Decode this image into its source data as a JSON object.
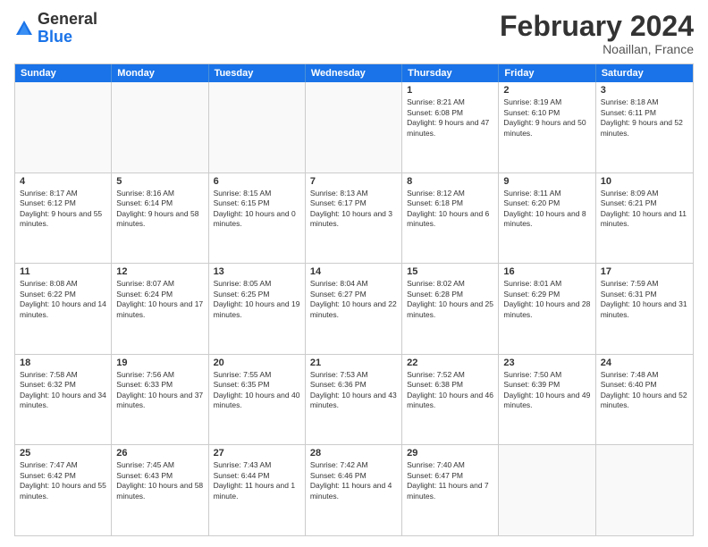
{
  "logo": {
    "general": "General",
    "blue": "Blue"
  },
  "header": {
    "month": "February 2024",
    "location": "Noaillan, France"
  },
  "weekdays": [
    "Sunday",
    "Monday",
    "Tuesday",
    "Wednesday",
    "Thursday",
    "Friday",
    "Saturday"
  ],
  "rows": [
    [
      {
        "day": "",
        "empty": true
      },
      {
        "day": "",
        "empty": true
      },
      {
        "day": "",
        "empty": true
      },
      {
        "day": "",
        "empty": true
      },
      {
        "day": "1",
        "sunrise": "8:21 AM",
        "sunset": "6:08 PM",
        "daylight": "9 hours and 47 minutes."
      },
      {
        "day": "2",
        "sunrise": "8:19 AM",
        "sunset": "6:10 PM",
        "daylight": "9 hours and 50 minutes."
      },
      {
        "day": "3",
        "sunrise": "8:18 AM",
        "sunset": "6:11 PM",
        "daylight": "9 hours and 52 minutes."
      }
    ],
    [
      {
        "day": "4",
        "sunrise": "8:17 AM",
        "sunset": "6:12 PM",
        "daylight": "9 hours and 55 minutes."
      },
      {
        "day": "5",
        "sunrise": "8:16 AM",
        "sunset": "6:14 PM",
        "daylight": "9 hours and 58 minutes."
      },
      {
        "day": "6",
        "sunrise": "8:15 AM",
        "sunset": "6:15 PM",
        "daylight": "10 hours and 0 minutes."
      },
      {
        "day": "7",
        "sunrise": "8:13 AM",
        "sunset": "6:17 PM",
        "daylight": "10 hours and 3 minutes."
      },
      {
        "day": "8",
        "sunrise": "8:12 AM",
        "sunset": "6:18 PM",
        "daylight": "10 hours and 6 minutes."
      },
      {
        "day": "9",
        "sunrise": "8:11 AM",
        "sunset": "6:20 PM",
        "daylight": "10 hours and 8 minutes."
      },
      {
        "day": "10",
        "sunrise": "8:09 AM",
        "sunset": "6:21 PM",
        "daylight": "10 hours and 11 minutes."
      }
    ],
    [
      {
        "day": "11",
        "sunrise": "8:08 AM",
        "sunset": "6:22 PM",
        "daylight": "10 hours and 14 minutes."
      },
      {
        "day": "12",
        "sunrise": "8:07 AM",
        "sunset": "6:24 PM",
        "daylight": "10 hours and 17 minutes."
      },
      {
        "day": "13",
        "sunrise": "8:05 AM",
        "sunset": "6:25 PM",
        "daylight": "10 hours and 19 minutes."
      },
      {
        "day": "14",
        "sunrise": "8:04 AM",
        "sunset": "6:27 PM",
        "daylight": "10 hours and 22 minutes."
      },
      {
        "day": "15",
        "sunrise": "8:02 AM",
        "sunset": "6:28 PM",
        "daylight": "10 hours and 25 minutes."
      },
      {
        "day": "16",
        "sunrise": "8:01 AM",
        "sunset": "6:29 PM",
        "daylight": "10 hours and 28 minutes."
      },
      {
        "day": "17",
        "sunrise": "7:59 AM",
        "sunset": "6:31 PM",
        "daylight": "10 hours and 31 minutes."
      }
    ],
    [
      {
        "day": "18",
        "sunrise": "7:58 AM",
        "sunset": "6:32 PM",
        "daylight": "10 hours and 34 minutes."
      },
      {
        "day": "19",
        "sunrise": "7:56 AM",
        "sunset": "6:33 PM",
        "daylight": "10 hours and 37 minutes."
      },
      {
        "day": "20",
        "sunrise": "7:55 AM",
        "sunset": "6:35 PM",
        "daylight": "10 hours and 40 minutes."
      },
      {
        "day": "21",
        "sunrise": "7:53 AM",
        "sunset": "6:36 PM",
        "daylight": "10 hours and 43 minutes."
      },
      {
        "day": "22",
        "sunrise": "7:52 AM",
        "sunset": "6:38 PM",
        "daylight": "10 hours and 46 minutes."
      },
      {
        "day": "23",
        "sunrise": "7:50 AM",
        "sunset": "6:39 PM",
        "daylight": "10 hours and 49 minutes."
      },
      {
        "day": "24",
        "sunrise": "7:48 AM",
        "sunset": "6:40 PM",
        "daylight": "10 hours and 52 minutes."
      }
    ],
    [
      {
        "day": "25",
        "sunrise": "7:47 AM",
        "sunset": "6:42 PM",
        "daylight": "10 hours and 55 minutes."
      },
      {
        "day": "26",
        "sunrise": "7:45 AM",
        "sunset": "6:43 PM",
        "daylight": "10 hours and 58 minutes."
      },
      {
        "day": "27",
        "sunrise": "7:43 AM",
        "sunset": "6:44 PM",
        "daylight": "11 hours and 1 minute."
      },
      {
        "day": "28",
        "sunrise": "7:42 AM",
        "sunset": "6:46 PM",
        "daylight": "11 hours and 4 minutes."
      },
      {
        "day": "29",
        "sunrise": "7:40 AM",
        "sunset": "6:47 PM",
        "daylight": "11 hours and 7 minutes."
      },
      {
        "day": "",
        "empty": true
      },
      {
        "day": "",
        "empty": true
      }
    ]
  ]
}
